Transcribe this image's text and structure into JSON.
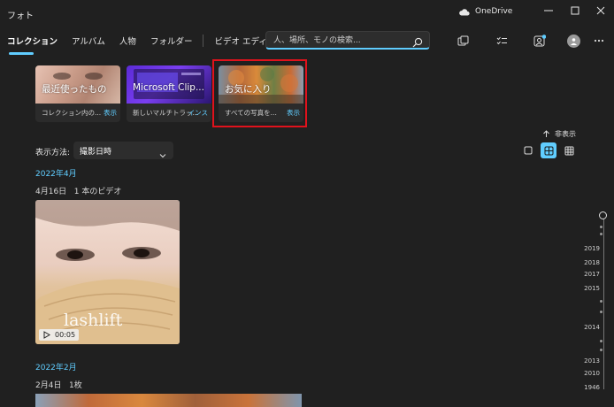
{
  "app": {
    "title": "フォト",
    "onedrive_label": "OneDrive",
    "window_controls": [
      "minimize-icon",
      "maximize-icon",
      "close-icon"
    ]
  },
  "nav": {
    "tabs": [
      {
        "label": "コレクション",
        "active": true
      },
      {
        "label": "アルバム",
        "active": false
      },
      {
        "label": "人物",
        "active": false
      },
      {
        "label": "フォルダー",
        "active": false
      },
      {
        "label": "ビデオ エディター",
        "active": false
      }
    ]
  },
  "search": {
    "placeholder": "人、場所、モノの検索...",
    "value": ""
  },
  "toolbar": {
    "icons": [
      "import-icon",
      "select-icon",
      "people-photos-icon",
      "account-icon",
      "more-icon"
    ]
  },
  "cards": [
    {
      "title": "最近使ったもの",
      "description": "コレクション内の...",
      "action": "表示"
    },
    {
      "title": "Microsoft Clip...",
      "description": "新しいマルチトラッ...",
      "action": "インス"
    },
    {
      "title": "お気に入り",
      "description": "すべての写真を...",
      "action": "表示"
    }
  ],
  "sort": {
    "label": "表示方法:",
    "value": "撮影日時"
  },
  "hide_label": "非表示",
  "view_modes": [
    "single-view-icon",
    "medium-grid-icon",
    "small-grid-icon"
  ],
  "active_view": "medium-grid-icon",
  "groups": [
    {
      "month": "2022年4月",
      "day": "4月16日",
      "count": "1 本のビデオ",
      "video_duration": "00:05",
      "video_overlay": "lashlift"
    },
    {
      "month": "2022年2月",
      "day": "2月4日",
      "count": "1枚"
    }
  ],
  "timeline": {
    "years": [
      "2019",
      "2018",
      "2017",
      "2015",
      "2014",
      "2013",
      "2010",
      "1946"
    ]
  },
  "colors": {
    "accent": "#60cdff",
    "highlight": "#e0121c",
    "background": "#202020"
  }
}
